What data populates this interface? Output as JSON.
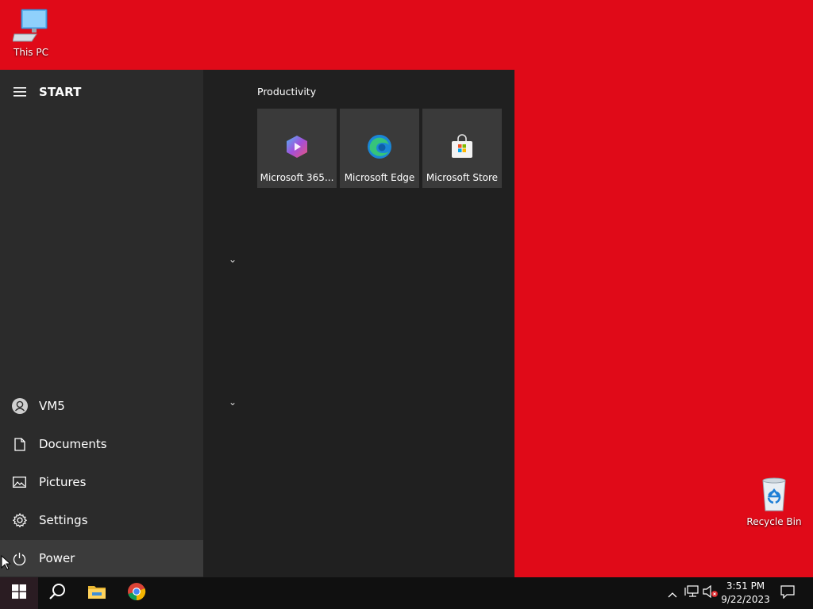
{
  "desktop": {
    "this_pc_label": "This PC",
    "recycle_bin_label": "Recycle Bin",
    "wallpaper_color": "#e00a18"
  },
  "start_menu": {
    "header_label": "START",
    "user_label": "VM5",
    "nav_items": [
      {
        "label": "Documents",
        "icon": "document-icon"
      },
      {
        "label": "Pictures",
        "icon": "pictures-icon"
      },
      {
        "label": "Settings",
        "icon": "gear-icon"
      },
      {
        "label": "Power",
        "icon": "power-icon"
      }
    ],
    "tile_group_title": "Productivity",
    "tiles": [
      {
        "label": "Microsoft 365...",
        "icon": "microsoft-365-icon"
      },
      {
        "label": "Microsoft Edge",
        "icon": "edge-icon"
      },
      {
        "label": "Microsoft Store",
        "icon": "store-icon"
      }
    ]
  },
  "taskbar": {
    "pinned": [
      "start-icon",
      "search-icon",
      "file-explorer-icon",
      "chrome-icon"
    ],
    "clock_time": "3:51 PM",
    "clock_date": "9/22/2023"
  }
}
